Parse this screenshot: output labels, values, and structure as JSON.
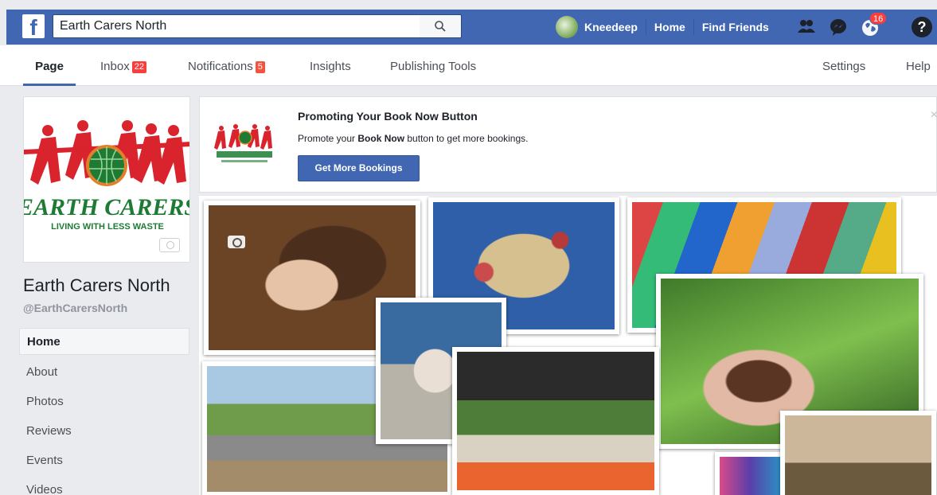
{
  "topbar": {
    "logo": "f",
    "search_value": "Earth Carers North",
    "user_name": "Kneedeep",
    "home": "Home",
    "find_friends": "Find Friends",
    "notification_count": "16",
    "help": "?"
  },
  "tabs": [
    {
      "label": "Page"
    },
    {
      "label": "Inbox",
      "badge": "22"
    },
    {
      "label": "Notifications",
      "badge": "5"
    },
    {
      "label": "Insights"
    },
    {
      "label": "Publishing Tools"
    },
    {
      "label": "Settings"
    },
    {
      "label": "Help"
    }
  ],
  "profile": {
    "logo_text": "EARTH CARERS",
    "logo_tagline": "LIVING WITH LESS WASTE",
    "name": "Earth Carers North",
    "handle": "@EarthCarersNorth"
  },
  "sidebar": {
    "items": [
      {
        "label": "Home"
      },
      {
        "label": "About"
      },
      {
        "label": "Photos"
      },
      {
        "label": "Reviews"
      },
      {
        "label": "Events"
      },
      {
        "label": "Videos"
      }
    ]
  },
  "promo": {
    "title": "Promoting Your Book Now Button",
    "text_before": "Promote your ",
    "text_bold": "Book Now",
    "text_after": " button to get more bookings.",
    "button": "Get More Bookings",
    "close": "×"
  },
  "colors": {
    "brand_blue": "#4267b2",
    "badge_red": "#fa3e3e",
    "logo_green": "#1e7b34",
    "logo_red": "#d9232d"
  }
}
